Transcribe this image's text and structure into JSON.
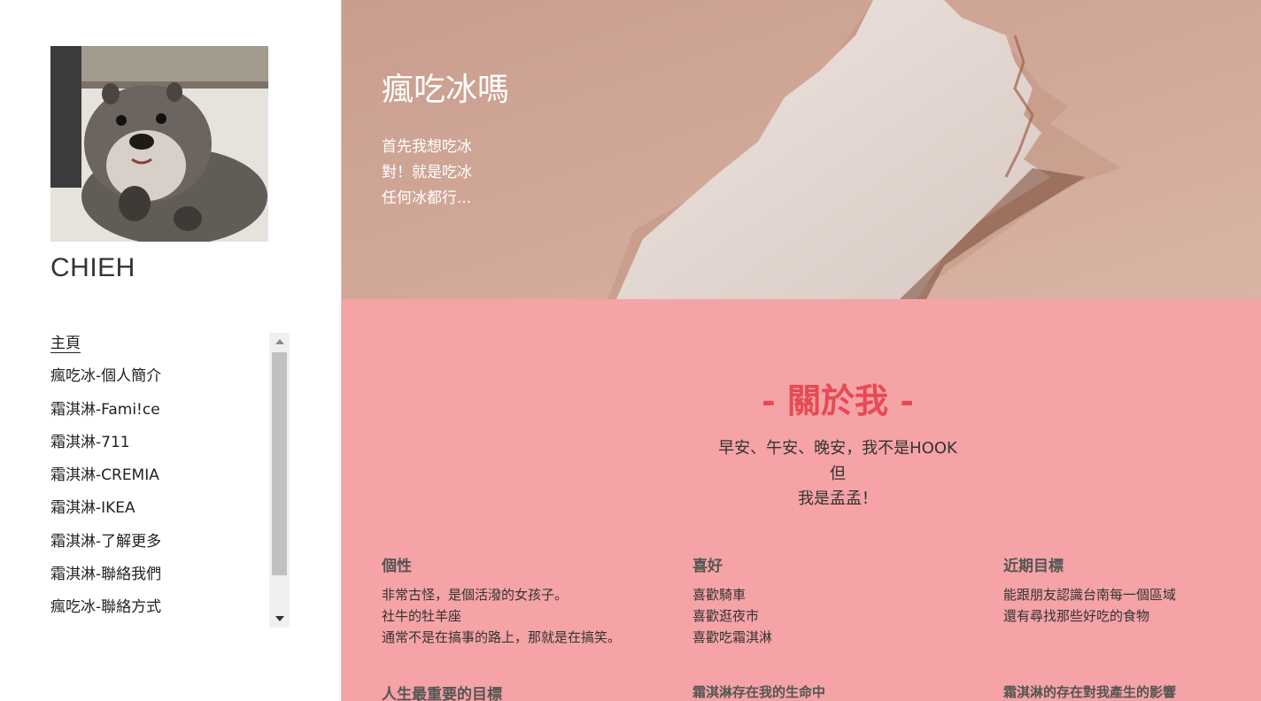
{
  "sidebar": {
    "site_name": "CHIEH",
    "nav": [
      {
        "label": "主頁",
        "active": true
      },
      {
        "label": "瘋吃冰-個人簡介"
      },
      {
        "label": "霜淇淋-Fami!ce"
      },
      {
        "label": "霜淇淋-711"
      },
      {
        "label": "霜淇淋-CREMIA"
      },
      {
        "label": "霜淇淋-IKEA"
      },
      {
        "label": "霜淇淋-了解更多"
      },
      {
        "label": "霜淇淋-聯絡我們"
      },
      {
        "label": "瘋吃冰-聯絡方式"
      }
    ]
  },
  "hero": {
    "title": "瘋吃冰嗎",
    "lines": [
      "首先我想吃冰",
      "對！就是吃冰",
      "任何冰都行..."
    ]
  },
  "about": {
    "title": "- 關於我 -",
    "intro": [
      "早安、午安、晚安，我不是HOOK",
      "但",
      "我是孟孟！"
    ],
    "columns": [
      {
        "heading": "個性",
        "lines": [
          "非常古怪，是個活潑的女孩子。",
          "社牛的牡羊座",
          "通常不是在搞事的路上，那就是在搞笑。"
        ]
      },
      {
        "heading": "喜好",
        "lines": [
          "喜歡騎車",
          "喜歡逛夜市",
          "喜歡吃霜淇淋"
        ]
      },
      {
        "heading": "近期目標",
        "lines": [
          "能跟朋友認識台南每一個區域",
          "還有尋找那些好吃的食物"
        ]
      }
    ],
    "row2": [
      "人生最重要的目標",
      "霜淇淋存在我的生命中",
      "霜淇淋的存在對我產生的影響"
    ]
  },
  "colors": {
    "about_bg": "#f5a3a6",
    "accent": "#e74a53",
    "hero_bg": "#c9a293"
  }
}
